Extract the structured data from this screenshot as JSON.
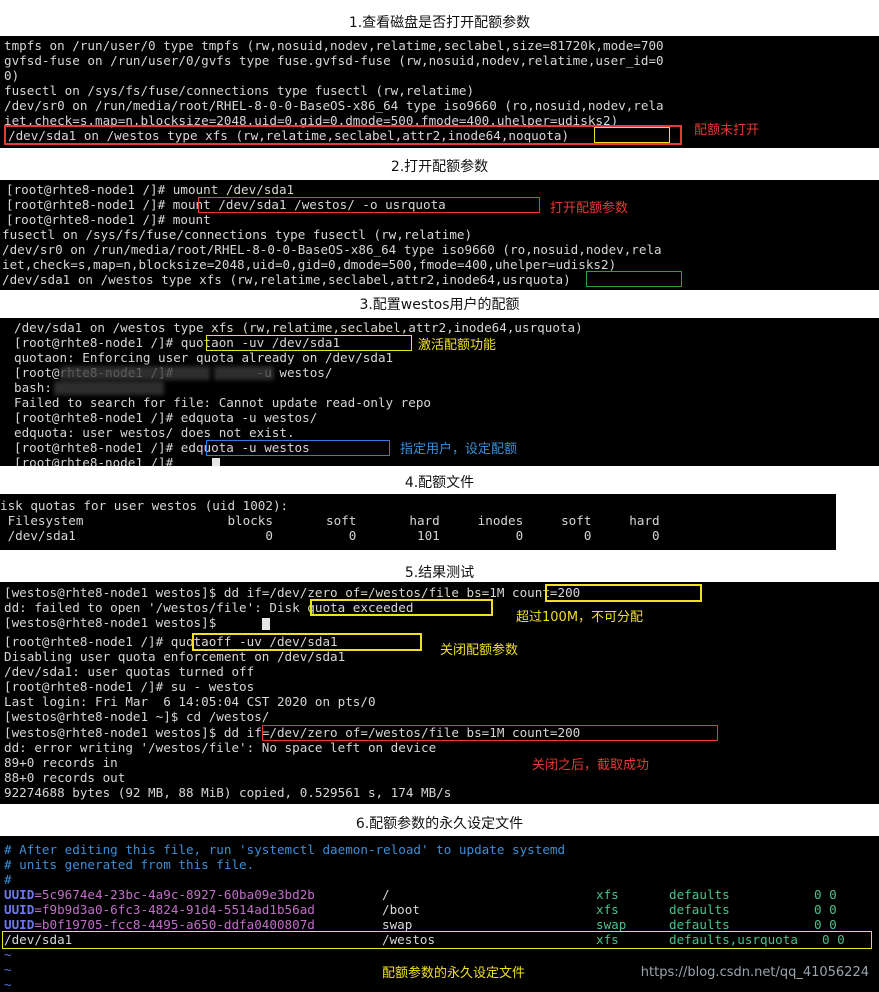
{
  "sections": {
    "s1": {
      "heading": "1.查看磁盘是否打开配额参数",
      "lines": [
        "tmpfs on /run/user/0 type tmpfs (rw,nosuid,nodev,relatime,seclabel,size=81720k,mode=700",
        "gvfsd-fuse on /run/user/0/gvfs type fuse.gvfsd-fuse (rw,nosuid,nodev,relatime,user_id=0",
        "0)",
        "fusectl on /sys/fs/fuse/connections type fusectl (rw,relatime)",
        "/dev/sr0 on /run/media/root/RHEL-8-0-0-BaseOS-x86_64 type iso9660 (ro,nosuid,nodev,rela",
        "iet,check=s,map=n,blocksize=2048,uid=0,gid=0,dmode=500,fmode=400,uhelper=udisks2)",
        "/dev/sda1 on /westos type xfs (rw,relatime,seclabel,attr2,inode64,noquota)"
      ],
      "note": "配额未打开"
    },
    "s2": {
      "heading": "2.打开配额参数",
      "lines": [
        "[root@rhte8-node1 /]# umount /dev/sda1",
        "[root@rhte8-node1 /]# mount /dev/sda1 /westos/ -o usrquota",
        "[root@rhte8-node1 /]# mount",
        "fusectl on /sys/fs/fuse/connections type fusectl (rw,relatime)",
        "/dev/sr0 on /run/media/root/RHEL-8-0-0-BaseOS-x86_64 type iso9660 (ro,nosuid,nodev,rela",
        "iet,check=s,map=n,blocksize=2048,uid=0,gid=0,dmode=500,fmode=400,uhelper=udisks2)",
        "/dev/sda1 on /westos type xfs (rw,relatime,seclabel,attr2,inode64,usrquota)"
      ],
      "note": "打开配额参数"
    },
    "s3": {
      "heading": "3.配置westos用户的配额",
      "lines": [
        "/dev/sda1 on /westos type xfs (rw,relatime,seclabel,attr2,inode64,usrquota)",
        "[root@rhte8-node1 /]# quotaon -uv /dev/sda1",
        "quotaon: Enforcing user quota already on /dev/sda1",
        "[root@rhte8-node1 /]#           -u westos/",
        "bash:",
        "Failed to search for file: Cannot update read-only repo",
        "[root@rhte8-node1 /]# edquota -u westos/",
        "edquota: user westos/ does not exist.",
        "[root@rhte8-node1 /]# edquota -u westos",
        "[root@rhte8-node1 /]# "
      ],
      "note1": "激活配额功能",
      "note2": "指定用户，设定配额"
    },
    "s4": {
      "heading": "4.配额文件",
      "lines": [
        "isk quotas for user westos (uid 1002):",
        " Filesystem                   blocks       soft       hard     inodes     soft     hard",
        " /dev/sda1                         0          0        101          0        0        0"
      ]
    },
    "s5": {
      "heading": "5.结果测试",
      "lines": [
        "[westos@rhte8-node1 westos]$ dd if=/dev/zero of=/westos/file bs=1M count=200",
        "dd: failed to open '/westos/file': Disk quota exceeded",
        "[westos@rhte8-node1 westos]$ ",
        "[root@rhte8-node1 /]# quotaoff -uv /dev/sda1",
        "Disabling user quota enforcement on /dev/sda1",
        "/dev/sda1: user quotas turned off",
        "[root@rhte8-node1 /]# su - westos",
        "Last login: Fri Mar  6 14:05:04 CST 2020 on pts/0",
        "[westos@rhte8-node1 ~]$ cd /westos/",
        "[westos@rhte8-node1 westos]$ dd if=/dev/zero of=/westos/file bs=1M count=200",
        "dd: error writing '/westos/file': No space left on device",
        "89+0 records in",
        "88+0 records out",
        "92274688 bytes (92 MB, 88 MiB) copied, 0.529561 s, 174 MB/s"
      ],
      "note1": "超过100M，不可分配",
      "note2": "关闭配额参数",
      "note3": "关闭之后，截取成功"
    },
    "s6": {
      "heading": "6.配额参数的永久设定文件",
      "comments": [
        "# After editing this file, run 'systemctl daemon-reload' to update systemd",
        "# units generated from this file.",
        "#"
      ],
      "fstab": [
        {
          "dev_key": "UUID",
          "dev_val": "=5c9674e4-23bc-4a9c-8927-60ba09e3bd2b",
          "mount": "/",
          "type": "xfs",
          "opts": "defaults",
          "dump": "0 0"
        },
        {
          "dev_key": "UUID",
          "dev_val": "=f9b9d3a0-6fc3-4824-91d4-5514ad1b56ad",
          "mount": "/boot",
          "type": "xfs",
          "opts": "defaults",
          "dump": "0 0"
        },
        {
          "dev_key": "UUID",
          "dev_val": "=b0f19705-fcc8-4495-a650-ddfa0400807d",
          "mount": "swap",
          "type": "swap",
          "opts": "defaults",
          "dump": "0 0"
        },
        {
          "dev_key": "",
          "dev_val": "/dev/sda1",
          "mount": "/westos",
          "type": "xfs",
          "opts": "defaults,usrquota",
          "dump": "0 0"
        }
      ],
      "tilde": "~",
      "note": "配额参数的永久设定文件"
    }
  },
  "watermark": "https://blog.csdn.net/qq_41056224",
  "colors": {
    "annotation_red": "#e53935",
    "annotation_yellow": "#f0e020",
    "annotation_blue": "#2f7de0",
    "annotation_green": "#2e9d3a"
  }
}
